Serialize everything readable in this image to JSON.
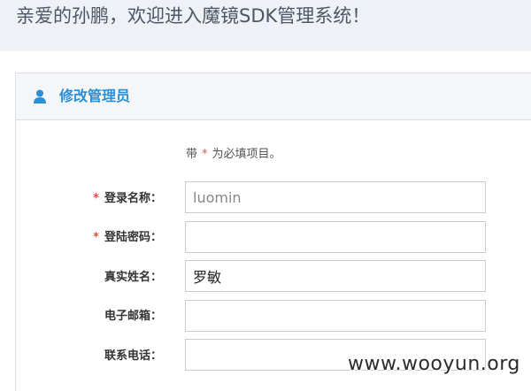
{
  "header": {
    "greeting": "亲爱的孙鹏，欢迎进入魔镜SDK管理系统！"
  },
  "panel": {
    "icon": "user-icon",
    "title": "修改管理员",
    "required_note": {
      "prefix": "带",
      "star": "*",
      "suffix": "为必填项目。"
    },
    "fields": [
      {
        "label": "登录名称：",
        "required": true,
        "value": "luomin"
      },
      {
        "label": "登陆密码：",
        "required": true,
        "value": ""
      },
      {
        "label": "真实姓名：",
        "required": false,
        "value": "罗敏"
      },
      {
        "label": "电子邮箱：",
        "required": false,
        "value": ""
      },
      {
        "label": "联系电话：",
        "required": false,
        "value": ""
      }
    ]
  },
  "watermark": "www.wooyun.org",
  "colors": {
    "accent": "#2a8fd6",
    "required": "#d9534f",
    "topbar_bg": "#eef2f7"
  }
}
